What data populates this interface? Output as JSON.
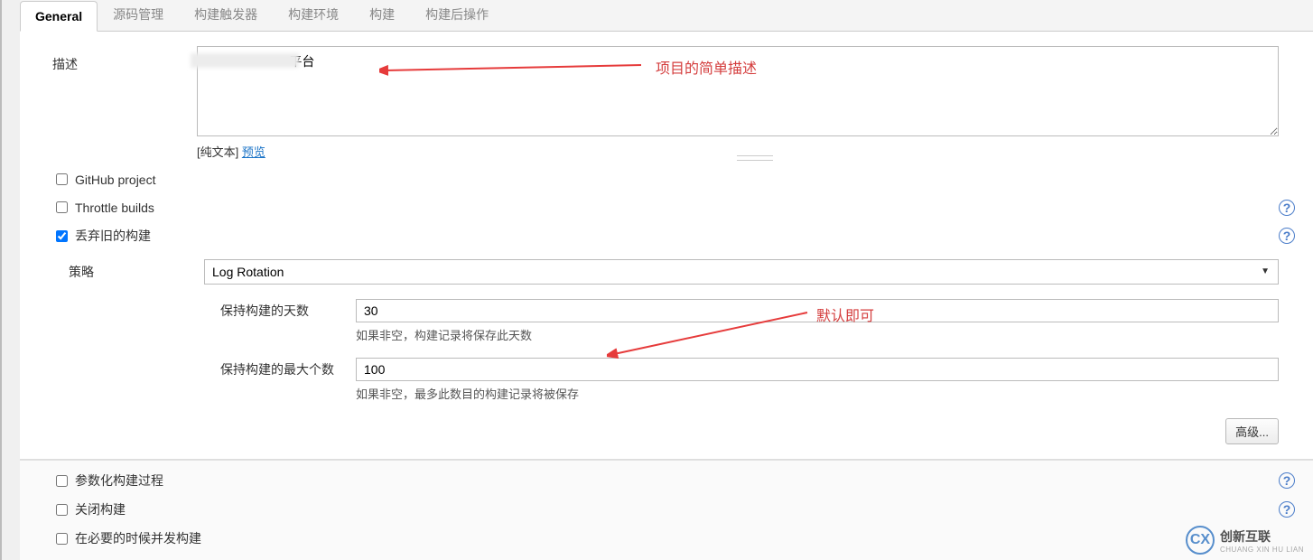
{
  "tabs": {
    "general": "General",
    "scm": "源码管理",
    "triggers": "构建触发器",
    "env": "构建环境",
    "build": "构建",
    "post": "构建后操作"
  },
  "description": {
    "label": "描述",
    "value": "                        平台",
    "plaintext_prefix": "[纯文本] ",
    "preview_link": "预览"
  },
  "checkboxes": {
    "github": "GitHub project",
    "throttle": "Throttle builds",
    "discard": "丢弃旧的构建",
    "param": "参数化构建过程",
    "close": "关闭构建",
    "concurrent": "在必要的时候并发构建"
  },
  "strategy": {
    "label": "策略",
    "value": "Log Rotation"
  },
  "keep_days": {
    "label": "保持构建的天数",
    "value": "30",
    "hint": "如果非空，构建记录将保存此天数"
  },
  "keep_max": {
    "label": "保持构建的最大个数",
    "value": "100",
    "hint": "如果非空，最多此数目的构建记录将被保存"
  },
  "advanced_button": "高级...",
  "annotations": {
    "desc": "项目的简单描述",
    "default": "默认即可"
  },
  "watermark": {
    "cn": "创新互联",
    "en": "CHUANG XIN HU LIAN"
  }
}
